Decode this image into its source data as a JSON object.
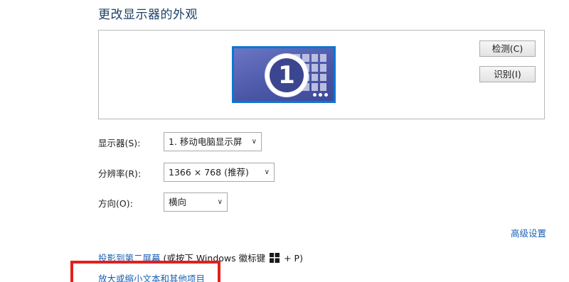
{
  "page": {
    "title": "更改显示器的外观"
  },
  "preview": {
    "monitor_number": "1",
    "detect_button": "检测(C)",
    "identify_button": "识别(I)"
  },
  "form": {
    "display_label": "显示器(S):",
    "display_value": "1. 移动电脑显示屏",
    "resolution_label": "分辨率(R):",
    "resolution_value": "1366 × 768 (推荐)",
    "orientation_label": "方向(O):",
    "orientation_value": "横向",
    "caret": "∨"
  },
  "links": {
    "advanced_settings": "高级设置",
    "project_link": "投影到第二屏幕",
    "project_hint_prefix": "(或按下 Windows 徽标键",
    "project_hint_suffix": "+ P)",
    "zoom_text": "放大或缩小文本和其他项目"
  },
  "colors": {
    "accent_link": "#1a5fb4",
    "title": "#1e3f66",
    "highlight": "#e0201e",
    "monitor_border": "#0a76d4"
  },
  "icons": {
    "windows_logo": "windows-logo-icon"
  }
}
